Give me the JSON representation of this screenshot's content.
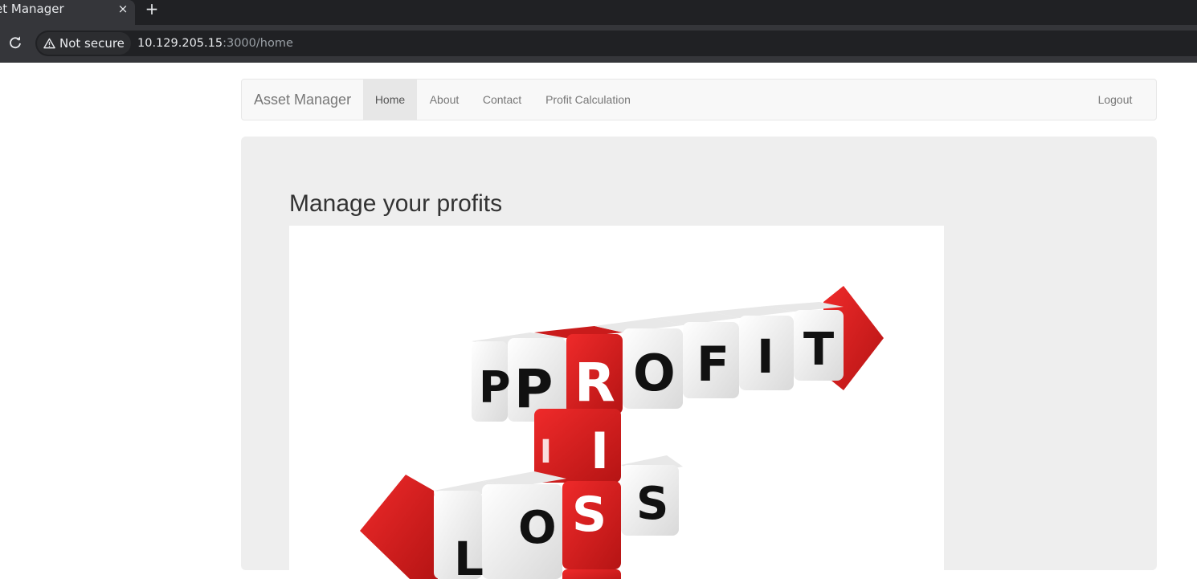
{
  "browser": {
    "tab_title": "et Manager",
    "tab_close_glyph": "×",
    "new_tab_glyph": "+",
    "security_label": "Not secure",
    "url_host": "10.129.205.15",
    "url_path": ":3000/home"
  },
  "navbar": {
    "brand": "Asset Manager",
    "items": [
      {
        "label": "Home",
        "active": true
      },
      {
        "label": "About",
        "active": false
      },
      {
        "label": "Contact",
        "active": false
      },
      {
        "label": "Profit Calculation",
        "active": false
      }
    ],
    "logout_label": "Logout"
  },
  "main": {
    "heading": "Manage your profits",
    "image": {
      "row_top": [
        "P",
        "R",
        "O",
        "F",
        "I",
        "T"
      ],
      "column": [
        "I"
      ],
      "row_bottom": [
        "L",
        "O",
        "S",
        "S"
      ],
      "accent_color": "#d81e1e",
      "cube_color": "#f2f2f2"
    }
  },
  "colors": {
    "tabstrip": "#202124",
    "toolbar": "#35363a",
    "navbar_bg": "#f8f8f8",
    "jumbotron_bg": "#eeeeee"
  },
  "icons": {
    "reload": "reload-icon",
    "warning": "warning-icon",
    "close": "close-icon",
    "new_tab": "plus-icon"
  }
}
